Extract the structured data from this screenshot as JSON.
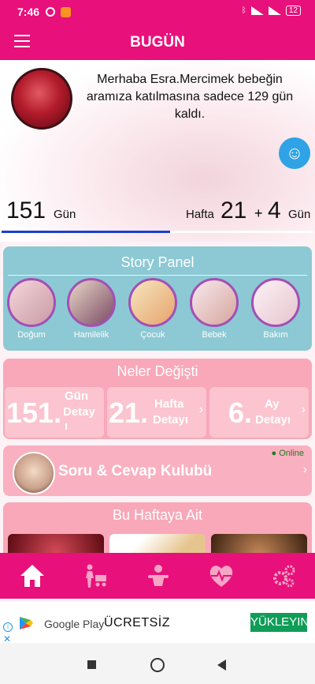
{
  "status_bar": {
    "time": "7:46",
    "battery": "12"
  },
  "app_bar": {
    "title": "BUGÜN"
  },
  "greeting": "Merhaba Esra.Mercimek bebeğin aramıza katılmasına sadece 129 gün kaldı.",
  "progress": {
    "days": "151",
    "days_label": "Gün",
    "week_label": "Hafta",
    "weeks": "21",
    "plus": "+",
    "extra_days": "4",
    "extra_days_label": "Gün",
    "progress_fraction": 0.54
  },
  "story_panel": {
    "title": "Story Panel",
    "items": [
      {
        "label": "Doğum"
      },
      {
        "label": "Hamilelik"
      },
      {
        "label": "Çocuk"
      },
      {
        "label": "Bebek"
      },
      {
        "label": "Bakım"
      }
    ]
  },
  "neler_degisti": {
    "title": "Neler Değişti",
    "cards": [
      {
        "number": "151.",
        "label_line1": "Gün",
        "label_line2": "Detay",
        "label_line3": "ı"
      },
      {
        "number": "21.",
        "label_line1": "Hafta",
        "label_line2": "Detayı"
      },
      {
        "number": "6.",
        "label_line1": "Ay",
        "label_line2": "Detayı"
      }
    ]
  },
  "club": {
    "label": "Soru & Cevap Kulubü",
    "status": "● Online"
  },
  "this_week": {
    "title": "Bu Haftaya Ait"
  },
  "ad": {
    "store": "Google Play",
    "free": "ÜCRETSİZ",
    "cta": "YÜKLEYIN"
  },
  "colors": {
    "primary": "#e8107a",
    "story_bg": "#8cc9d4",
    "pink_panel": "#f8a8b8",
    "progress": "#1a3fd0"
  },
  "icons": {
    "nav": [
      "home-icon",
      "pregnant-stroller-icon",
      "baby-icon",
      "heart-pulse-icon",
      "gears-icon"
    ],
    "menu": "hamburger-menu-icon",
    "fab": "baby-face-icon"
  }
}
